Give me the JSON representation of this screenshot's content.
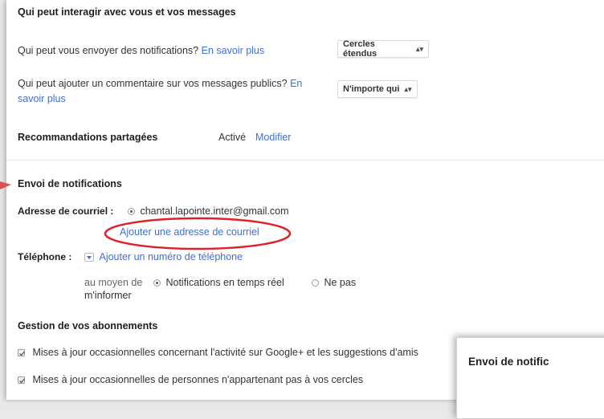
{
  "interactions": {
    "title": "Qui peut interagir avec vous et vos messages",
    "notifications_q": "Qui peut vous envoyer des notifications?",
    "notifications_link": "En savoir plus",
    "notifications_value": "Cercles étendus",
    "comment_q_line1": "Qui peut ajouter un commentaire sur vos messages publics?",
    "comment_link_part1": "En",
    "comment_link_part2": "savoir plus",
    "comment_value": "N'importe qui"
  },
  "recommendations": {
    "label": "Recommandations partagées",
    "status": "Activé",
    "modify": "Modifier"
  },
  "notifications": {
    "title": "Envoi de notifications",
    "email_label": "Adresse de courriel :",
    "email_value": "chantal.lapointe.inter@gmail.com",
    "add_email": "Ajouter une adresse de courriel",
    "phone_label": "Téléphone :",
    "add_phone": "Ajouter un numéro de téléphone",
    "via_line1": "au moyen de",
    "via_line2": "m'informer",
    "realtime": "Notifications en temps réel",
    "no": "Ne pas"
  },
  "subscriptions": {
    "title": "Gestion de vos abonnements",
    "items": [
      "Mises à jour occasionnelles concernant l'activité sur Google+ et les suggestions d'amis",
      "Mises à jour occasionnelles de personnes n'appartenant pas à vos cercles"
    ]
  },
  "popup": {
    "title": "Envoi de notific"
  },
  "colors": {
    "link": "#3f6fd6",
    "highlight_circle": "#e0202a",
    "arrow": "#d9534f"
  }
}
